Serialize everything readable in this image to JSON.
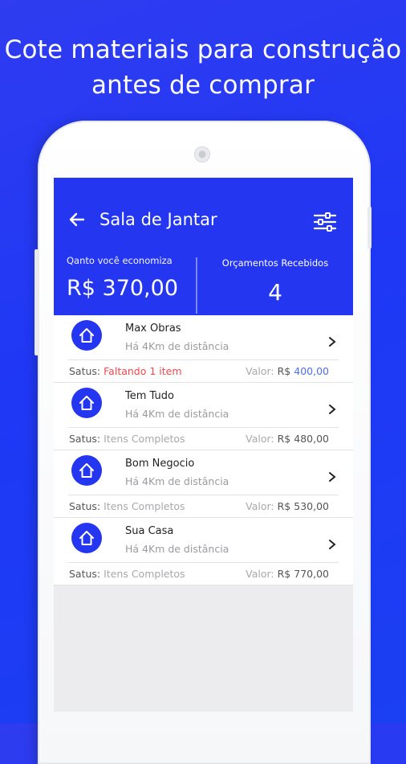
{
  "headline": {
    "line1": "Cote materiais para construção",
    "line2": "antes de comprar"
  },
  "appbar": {
    "title": "Sala de Jantar",
    "back_icon": "arrow-left-icon",
    "filter_icon": "sliders-icon",
    "savings_label": "Qanto você economiza",
    "savings_value": "R$ 370,00",
    "quotes_label": "Orçamentos Recebidos",
    "quotes_value": "4"
  },
  "stores": [
    {
      "name": "Max Obras",
      "distance": "Há 4Km de distância",
      "status_label": "Satus:",
      "status_value": "Faltando 1 item",
      "status_alert": true,
      "price_label": "Valor:",
      "currency": "R$",
      "price": "400,00",
      "price_highlight": true
    },
    {
      "name": "Tem Tudo",
      "distance": "Há 4Km de distância",
      "status_label": "Satus:",
      "status_value": "Itens Completos",
      "status_alert": false,
      "price_label": "Valor:",
      "currency": "R$",
      "price": "480,00",
      "price_highlight": false
    },
    {
      "name": "Bom Negocio",
      "distance": "Há 4Km de distância",
      "status_label": "Satus:",
      "status_value": "Itens Completos",
      "status_alert": false,
      "price_label": "Valor:",
      "currency": "R$",
      "price": "530,00",
      "price_highlight": false
    },
    {
      "name": "Sua Casa",
      "distance": "Há 4Km de distância",
      "status_label": "Satus:",
      "status_value": "Itens Completos",
      "status_alert": false,
      "price_label": "Valor:",
      "currency": "R$",
      "price": "770,00",
      "price_highlight": false
    }
  ],
  "colors": {
    "primary": "#2436ef",
    "alert": "#f0474c",
    "highlight_price": "#4f6cf3"
  }
}
